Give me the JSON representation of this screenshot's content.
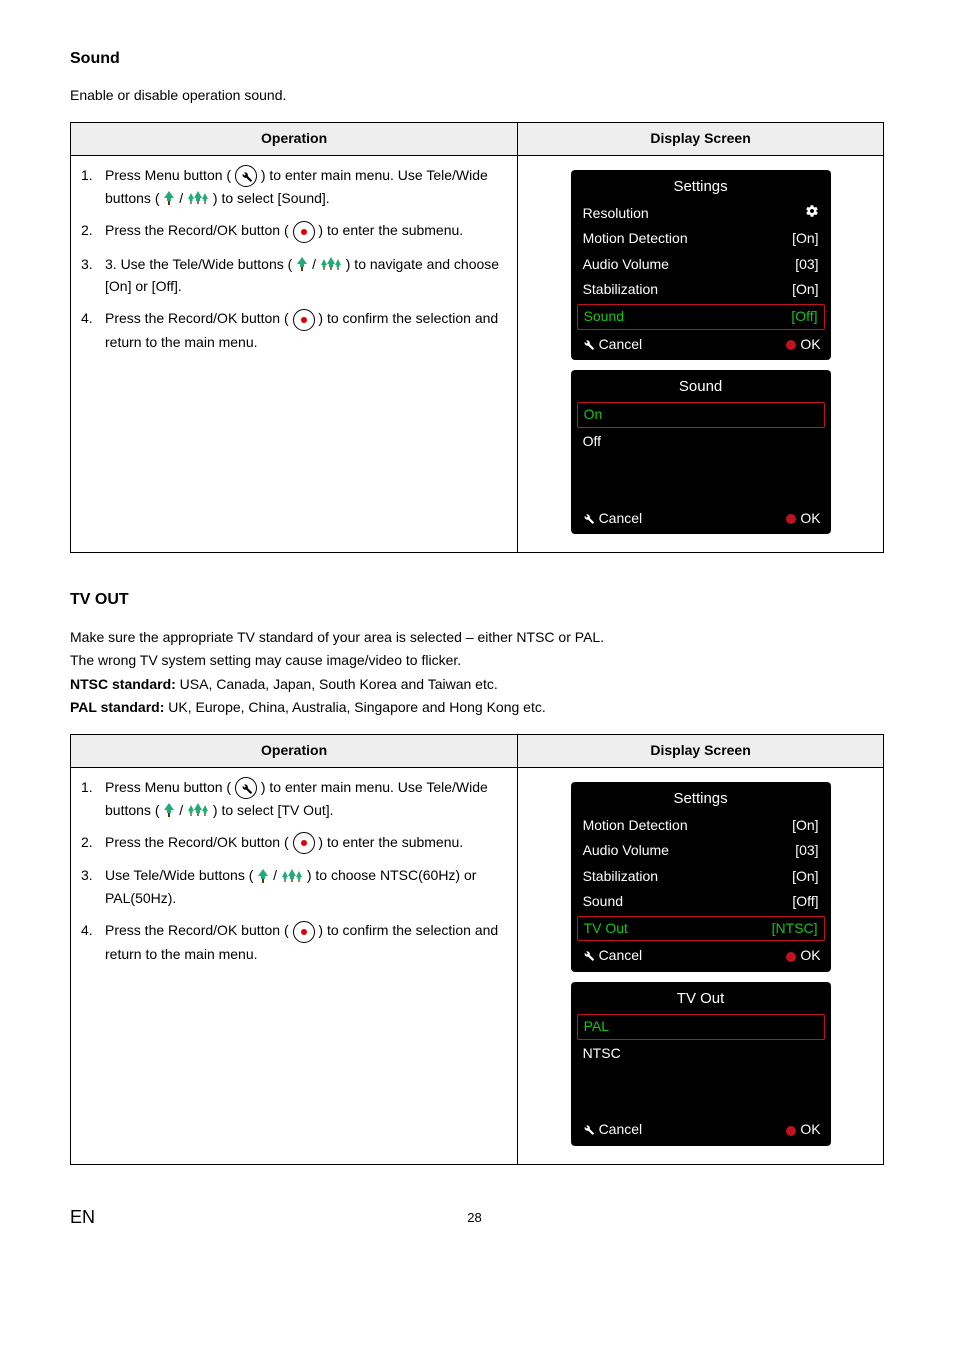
{
  "sections": {
    "sound": {
      "title": "Sound",
      "intro": [
        "Enable or disable operation sound."
      ],
      "headers": {
        "op": "Operation",
        "ds": "Display Screen"
      },
      "steps": [
        {
          "num": "1.",
          "pre": "Press Menu button ( ",
          "icon": "menu",
          "mid": " ) to enter main menu. Use Tele/Wide buttons ( ",
          "icon2": "tele",
          "post": " ) to select [Sound]."
        },
        {
          "num": "2.",
          "pre": "Press the Record/OK button ( ",
          "icon": "rec",
          "post": " ) to enter the submenu."
        },
        {
          "num": "3.",
          "pre": "3. Use the Tele/Wide buttons ( ",
          "icon": "tele-only",
          "post": " ) to navigate and choose [On] or [Off]."
        },
        {
          "num": "4.",
          "pre": " Press the Record/OK button ( ",
          "icon": "rec",
          "post": " ) to confirm the selection and return to the main menu."
        }
      ],
      "screen1": {
        "title": "Settings",
        "rows": [
          {
            "label": "Resolution",
            "val": "gear"
          },
          {
            "label": "Motion Detection",
            "val": "[On]"
          },
          {
            "label": "Audio Volume",
            "val": "[03]"
          },
          {
            "label": "Stabilization",
            "val": "[On]"
          },
          {
            "label": "Sound",
            "val": "[Off]",
            "hl": true
          }
        ],
        "cancel": "Cancel",
        "ok": "OK"
      },
      "screen2": {
        "title": "Sound",
        "opts": [
          {
            "label": "On",
            "hl": true
          },
          {
            "label": "Off"
          }
        ],
        "cancel": "Cancel",
        "ok": "OK"
      }
    },
    "tvout": {
      "title": "TV OUT",
      "intro": [
        "Make sure the appropriate TV standard of your area is selected – either NTSC or PAL.",
        "The wrong TV system setting may cause image/video to flicker.",
        "<b>NTSC standard:</b> USA, Canada, Japan, South Korea and Taiwan etc.",
        "<b>PAL standard:</b> UK, Europe, China, Australia, Singapore and Hong Kong etc."
      ],
      "headers": {
        "op": "Operation",
        "ds": "Display Screen"
      },
      "steps": [
        {
          "num": "1.",
          "pre": "Press Menu button ( ",
          "icon": "menu",
          "mid": " ) to enter main menu. Use Tele/Wide buttons ( ",
          "icon2": "tele",
          "post": " ) to select [TV Out]."
        },
        {
          "num": "2.",
          "pre": "Press the Record/OK button ( ",
          "icon": "rec",
          "post": " ) to enter the submenu."
        },
        {
          "num": "3.",
          "pre": "Use Tele/Wide buttons ( ",
          "icon": "tele-only",
          "post": " ) to choose NTSC(60Hz) or PAL(50Hz)."
        },
        {
          "num": "4.",
          "pre": "Press the Record/OK button ( ",
          "icon": "rec",
          "post": " ) to confirm the selection and return to the main menu."
        }
      ],
      "screen1": {
        "title": "Settings",
        "rows": [
          {
            "label": "Motion Detection",
            "val": "[On]"
          },
          {
            "label": "Audio Volume",
            "val": "[03]"
          },
          {
            "label": "Stabilization",
            "val": "[On]"
          },
          {
            "label": "Sound",
            "val": "[Off]"
          },
          {
            "label": "TV Out",
            "val": "[NTSC]",
            "hl": true
          }
        ],
        "cancel": "Cancel",
        "ok": "OK"
      },
      "screen2": {
        "title": "TV Out",
        "opts": [
          {
            "label": "PAL",
            "hl": true
          },
          {
            "label": "NTSC"
          }
        ],
        "cancel": "Cancel",
        "ok": "OK"
      }
    }
  },
  "footer": {
    "en": "EN",
    "page": "28"
  }
}
